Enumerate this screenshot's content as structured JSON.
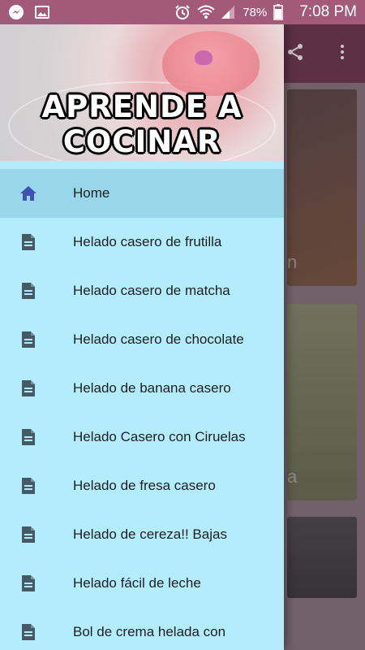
{
  "status_bar": {
    "left_icons": [
      "messenger-icon",
      "gallery-icon"
    ],
    "right_icons": [
      "alarm-icon",
      "wifi-icon",
      "signal-icon",
      "battery-icon"
    ],
    "battery": "78%",
    "time": "7:08 PM"
  },
  "app": {
    "toolbar_icons": [
      "share-icon",
      "more-vert-icon"
    ],
    "card_captions": [
      "n",
      "a"
    ]
  },
  "drawer": {
    "header_title": "APRENDE A COCINAR",
    "items": [
      {
        "label": "Home",
        "icon": "home-icon",
        "active": true
      },
      {
        "label": "Helado casero de frutilla",
        "icon": "document-icon"
      },
      {
        "label": "Helado casero de matcha",
        "icon": "document-icon"
      },
      {
        "label": "Helado casero de chocolate",
        "icon": "document-icon"
      },
      {
        "label": "Helado de banana casero",
        "icon": "document-icon"
      },
      {
        "label": "Helado Casero con Ciruelas",
        "icon": "document-icon"
      },
      {
        "label": "Helado de fresa casero",
        "icon": "document-icon"
      },
      {
        "label": "Helado de cereza!! Bajas",
        "icon": "document-icon"
      },
      {
        "label": "Helado fácil de leche",
        "icon": "document-icon"
      },
      {
        "label": "Bol de crema helada con",
        "icon": "document-icon"
      }
    ]
  },
  "colors": {
    "status_bar": "#a35a7a",
    "drawer_bg": "#b3ecfc",
    "active_item": "#98d6ea",
    "home_icon": "#3f51b5",
    "doc_icon": "#455a64"
  }
}
